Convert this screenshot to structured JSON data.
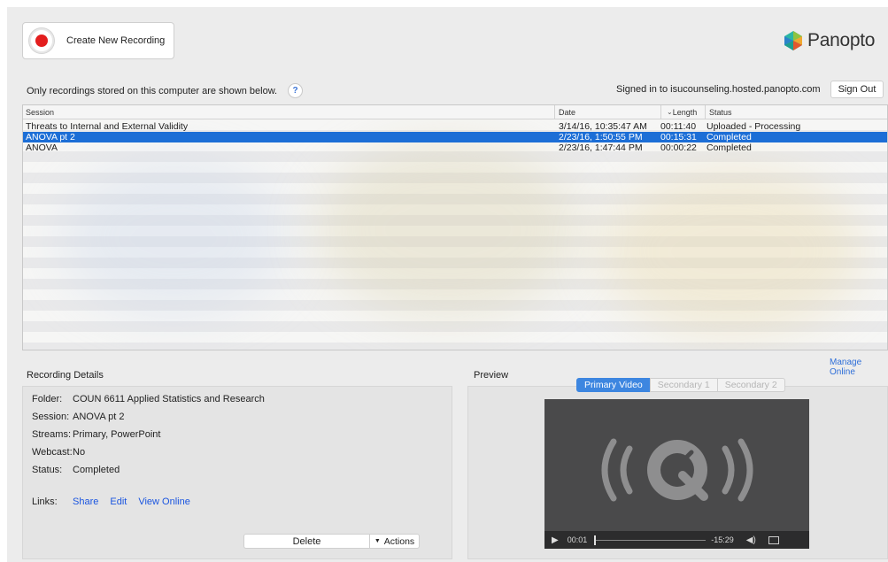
{
  "toolbar": {
    "create_label": "Create New Recording"
  },
  "brand": {
    "name": "Panopto"
  },
  "notice": {
    "text": "Only recordings stored on this computer are shown below.",
    "help_glyph": "?"
  },
  "account": {
    "signed_in_text": "Signed in to isucounseling.hosted.panopto.com",
    "sign_out_label": "Sign Out"
  },
  "table": {
    "columns": {
      "session": "Session",
      "date": "Date",
      "length": "Length",
      "status": "Status"
    },
    "rows": [
      {
        "session": "Threats to Internal and External Validity",
        "date": "3/14/16, 10:35:47 AM",
        "length": "00:11:40",
        "status": "Uploaded - Processing"
      },
      {
        "session": "ANOVA pt 2",
        "date": "2/23/16, 1:50:55 PM",
        "length": "00:15:31",
        "status": "Completed"
      },
      {
        "session": "ANOVA",
        "date": "2/23/16, 1:47:44 PM",
        "length": "00:00:22",
        "status": "Completed"
      }
    ]
  },
  "manage_online": "Manage Online",
  "details": {
    "title": "Recording Details",
    "folder_key": "Folder:",
    "folder": "COUN 6611 Applied Statistics and Research",
    "session_key": "Session:",
    "session": "ANOVA pt 2",
    "streams_key": "Streams:",
    "streams": "Primary, PowerPoint",
    "webcast_key": "Webcast:",
    "webcast": "No",
    "status_key": "Status:",
    "status": "Completed",
    "links_key": "Links:",
    "links": {
      "share": "Share",
      "edit": "Edit",
      "view_online": "View Online"
    },
    "delete_label": "Delete",
    "actions_label": "Actions"
  },
  "preview": {
    "title": "Preview",
    "tabs": [
      "Primary Video",
      "Secondary 1",
      "Secondary 2"
    ],
    "elapsed": "00:01",
    "remaining": "-15:29"
  },
  "colors": {
    "accent": "#1c6ed6",
    "record": "#e31e1e",
    "link": "#1a55e0"
  }
}
